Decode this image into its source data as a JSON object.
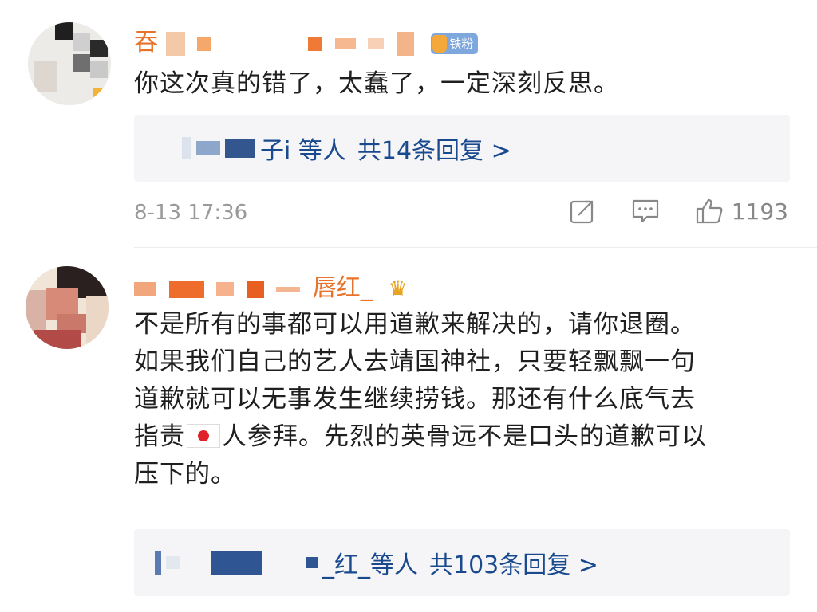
{
  "comments": [
    {
      "username": "吞",
      "fan_badge": "铁粉",
      "text": "你这次真的错了，太蠢了，一定深刻反思。",
      "reply": {
        "names": "子i 等人",
        "link": "共14条回复 >"
      },
      "timestamp": "8-13 17:36",
      "likes": "1193"
    },
    {
      "username": "唇红_",
      "text_lines": [
        "不是所有的事都可以用道歉来解决的，请你退圈。",
        "如果我们自己的艺人去靖国神社，只要轻飘飘一句",
        "道歉就可以无事发生继续捞钱。那还有什么底气去",
        "指责",
        "人参拜。先烈的英骨远不是口头的道歉可以",
        "压下的。"
      ],
      "reply": {
        "names": "_红_等人",
        "link": "共103条回复 >"
      }
    }
  ],
  "icons": {
    "share": "share-icon",
    "comment": "comment-icon",
    "like": "thumbs-up-icon",
    "flag": "japan-flag-emoji",
    "crown": "crown-badge-icon"
  }
}
